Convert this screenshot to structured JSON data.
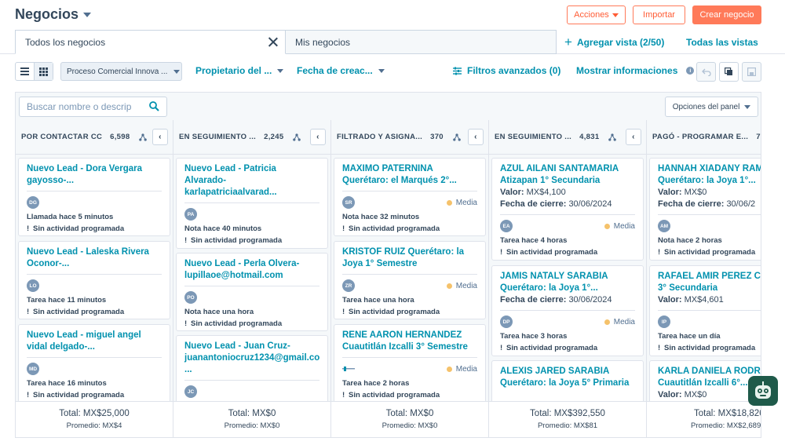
{
  "header": {
    "title": "Negocios",
    "actions_label": "Acciones",
    "import_label": "Importar",
    "create_label": "Crear negocio"
  },
  "tabs": {
    "active": "Todos los negocios",
    "inactive": "Mis negocios",
    "add_view": "Agregar vista (2/50)",
    "all_views": "Todas las vistas"
  },
  "filters": {
    "pipeline": "Proceso Comercial Innova ...",
    "owner": "Propietario del ...",
    "created": "Fecha de creac...",
    "advanced": "Filtros avanzados (0)",
    "show_info": "Mostrar informaciones"
  },
  "board": {
    "search_placeholder": "Buscar nombre o descrip",
    "panel_options": "Opciones del panel"
  },
  "columns": [
    {
      "name": "POR CONTACTAR CC",
      "count": "6,598",
      "total": "Total: MX$25,000",
      "average": "Promedio: MX$4",
      "cards": [
        {
          "title": "Nuevo Lead - Dora Vergara\ngayosso-...",
          "avatar": "DG",
          "activity": "Llamada hace 5 minutos",
          "next": "Sin actividad programada"
        },
        {
          "title": "Nuevo Lead - Laleska Rivera\nOconor-...",
          "avatar": "LO",
          "activity": "Tarea hace 11 minutos",
          "next": "Sin actividad programada"
        },
        {
          "title": "Nuevo Lead - miguel angel\nvidal delgado-...",
          "avatar": "MD",
          "activity": "Tarea hace 16 minutos",
          "next": "Sin actividad programada"
        }
      ]
    },
    {
      "name": "EN SEGUIMIENTO ...",
      "count": "2,245",
      "total": "Total: MX$0",
      "average": "Promedio: MX$0",
      "cards": [
        {
          "title": "Nuevo Lead - Patricia\nAlvarado-\nkarlapatriciaalvarad...",
          "avatar": "PA",
          "activity": "Nota hace 40 minutos",
          "next": "Sin actividad programada"
        },
        {
          "title": "Nuevo Lead - Perla Olvera-\nlupillaoe@hotmail.com",
          "avatar": "PO",
          "activity": "Nota hace una hora",
          "next": "Sin actividad programada"
        },
        {
          "title": "Nuevo Lead - Juan Cruz-\njuanantoniocruz1234@gmail.co\n...",
          "avatar": "JC",
          "activity": "",
          "next": ""
        }
      ]
    },
    {
      "name": "FILTRADO Y ASIGNA...",
      "count": "370",
      "total": "Total: MX$0",
      "average": "Promedio: MX$0",
      "cards": [
        {
          "title": "MAXIMO PATERNINA\nQuerétaro: el Marqués 2°...",
          "avatar": "SR",
          "priority": "Media",
          "activity": "Nota hace 32 minutos",
          "next": "Sin actividad programada"
        },
        {
          "title": "KRISTOF RUIZ  Querétaro: la\nJoya 1° Semestre",
          "avatar": "ZR",
          "priority": "Media",
          "activity": "Tarea hace una hora",
          "next": "Sin actividad programada"
        },
        {
          "title": "RENE AARON HERNANDEZ\nCuautitlán Izcalli 3° Semestre",
          "avatar": "",
          "priority": "Media",
          "activity": "Tarea hace 2 horas",
          "next": "Sin actividad programada"
        }
      ]
    },
    {
      "name": "EN SEGUIMIENTO ...",
      "count": "4,831",
      "total": "Total: MX$392,550",
      "average": "Promedio: MX$81",
      "cards": [
        {
          "title": "AZUL AILANI SANTAMARIA\nAtizapan 1° Secundaria",
          "value": "MX$4,100",
          "close": "30/06/2024",
          "avatar": "EA",
          "priority": "Media",
          "activity": "Tarea hace 4 horas",
          "next": "Sin actividad programada"
        },
        {
          "title": "JAMIS NATALY SARABIA\nQuerétaro: la Joya 1°...",
          "close": "30/06/2024",
          "avatar": "DP",
          "priority": "Media",
          "activity": "Tarea hace 3 horas",
          "next": "Sin actividad programada"
        },
        {
          "title": "ALEXIS JARED SARABIA\nQuerétaro: la Joya 5° Primaria",
          "avatar": "",
          "activity": "",
          "next": ""
        }
      ]
    },
    {
      "name": "PAGÓ - PROGRAMAR E...",
      "count": "7",
      "total": "Total: MX$18,826",
      "average": "Promedio: MX$2,689",
      "cards": [
        {
          "title": "HANNAH XIADANY RAM\nQuerétaro: la Joya 1°...",
          "value": "MX$0",
          "close": "30/06/2",
          "avatar": "AM",
          "activity": "Nota hace 2 horas",
          "next": "Sin actividad programada"
        },
        {
          "title": "RAFAEL AMIR PEREZ  C\n3° Secundaria",
          "value": "MX$4,601",
          "avatar": "IP",
          "activity": "Tarea hace un día",
          "next": "Sin actividad programada"
        },
        {
          "title": "KARLA DANIELA RODR\nCuautitlán Izcalli 6°...",
          "value": "MX$0",
          "avatar": "",
          "activity": "",
          "next": ""
        }
      ]
    }
  ],
  "labels": {
    "value": "Valor:",
    "close": "Fecha de cierre:"
  }
}
